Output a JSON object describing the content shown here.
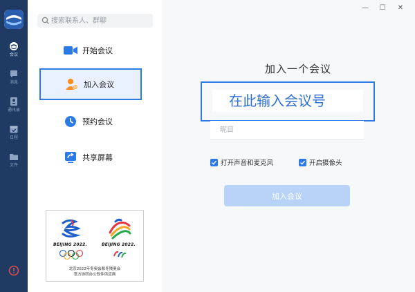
{
  "search": {
    "placeholder": "搜索联系人、群聊"
  },
  "rail": {
    "items": [
      {
        "label": "会议",
        "icon": "meeting-icon"
      },
      {
        "label": "消息",
        "icon": "chat-icon"
      },
      {
        "label": "通讯录",
        "icon": "contacts-icon"
      },
      {
        "label": "日程",
        "icon": "calendar-icon"
      },
      {
        "label": "文件",
        "icon": "folder-icon"
      }
    ]
  },
  "menu": {
    "items": [
      {
        "label": "开始会议",
        "icon": "video-camera-icon"
      },
      {
        "label": "加入会议",
        "icon": "join-user-icon"
      },
      {
        "label": "预约会议",
        "icon": "clock-icon"
      },
      {
        "label": "共享屏幕",
        "icon": "share-screen-icon"
      }
    ],
    "selected_index": 1
  },
  "card": {
    "beijing_left": "BEIJING 2022.",
    "beijing_right": "BEIJING 2022.",
    "caption_line1": "北京2022年冬奥会和冬残奥会",
    "caption_line2": "官方协同办公软件供应商"
  },
  "window": {
    "minimize": "—",
    "maximize": "☐",
    "close": "✕"
  },
  "join": {
    "title": "加入一个会议",
    "meeting_id_placeholder": "在此输入会议号",
    "name_placeholder": "昵目",
    "audio_label": "打开声音和麦克风",
    "audio_checked": true,
    "camera_label": "开启摄像头",
    "camera_checked": true,
    "button_label": "加入会议"
  },
  "colors": {
    "rail_bg": "#1f3a63",
    "accent": "#2c7be5",
    "button_disabled": "#b9d3f8"
  }
}
